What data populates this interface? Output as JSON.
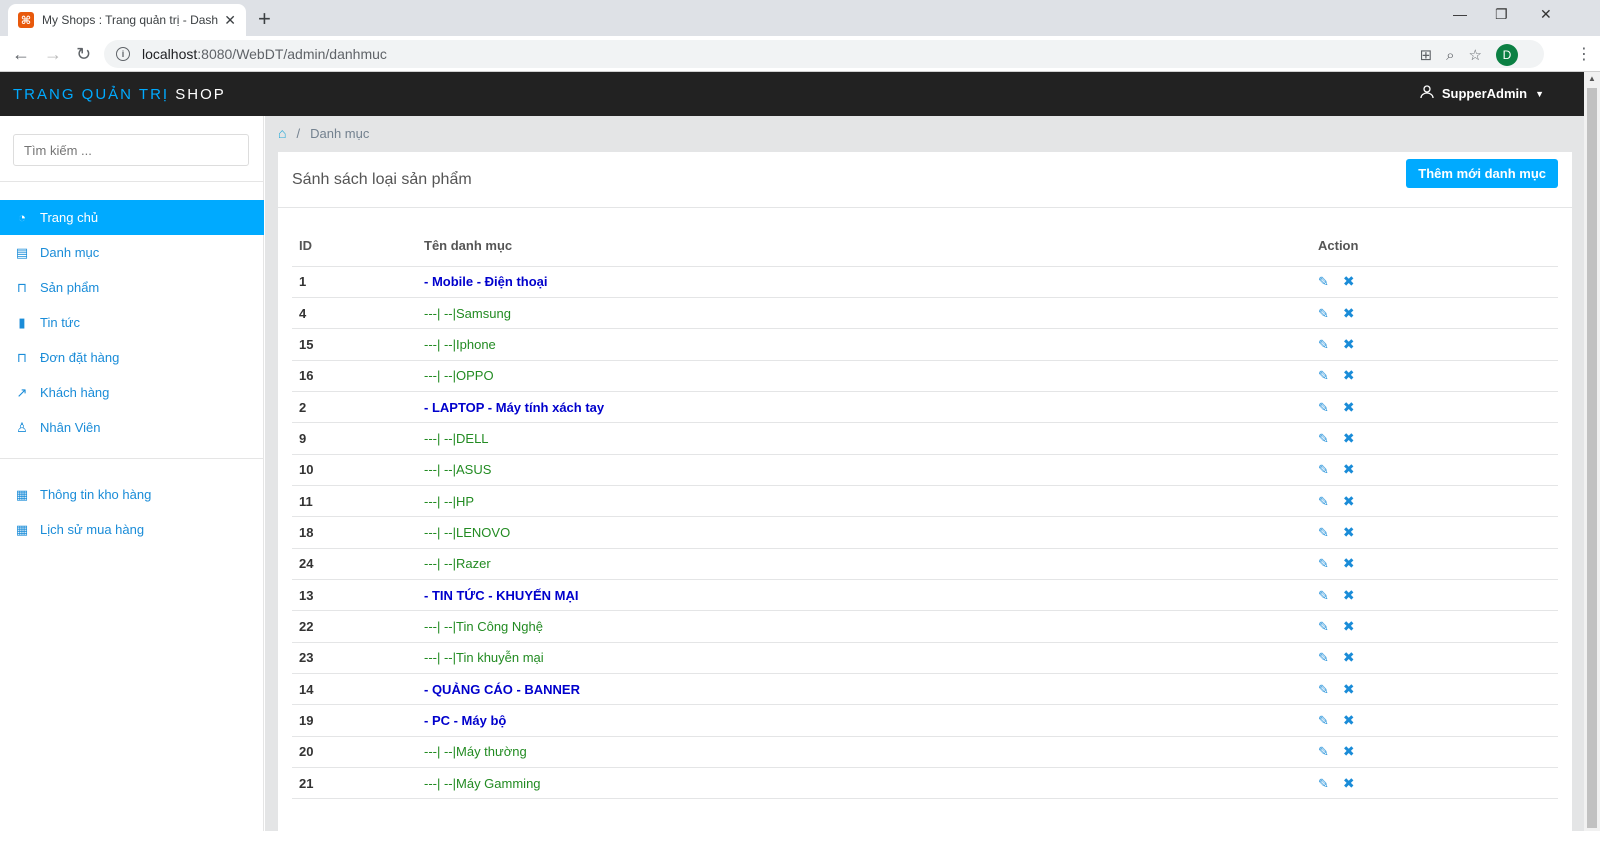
{
  "browser": {
    "tab_title": "My Shops : Trang quản trị - Dash",
    "url_host": "localhost",
    "url_rest": ":8080/WebDT/admin/danhmuc",
    "profile_initial": "D"
  },
  "header": {
    "brand_part1": "TRANG QUẢN TRỊ",
    "brand_part2": "SHOP",
    "user": "SupperAdmin"
  },
  "sidebar": {
    "search_placeholder": "Tìm kiếm ...",
    "items": [
      {
        "label": "Trang chủ",
        "icon": "dashboard-icon",
        "active": true
      },
      {
        "label": "Danh mục",
        "icon": "clipboard-icon"
      },
      {
        "label": "Sản phẩm",
        "icon": "bag-icon"
      },
      {
        "label": "Tin tức",
        "icon": "file-icon"
      },
      {
        "label": "Đơn đặt hàng",
        "icon": "bag-icon"
      },
      {
        "label": "Khách hàng",
        "icon": "chart-icon"
      },
      {
        "label": "Nhân Viên",
        "icon": "user-icon"
      }
    ],
    "items2": [
      {
        "label": "Thông tin kho hàng",
        "icon": "calendar-icon"
      },
      {
        "label": "Lịch sử mua hàng",
        "icon": "table-icon"
      }
    ]
  },
  "breadcrumb": {
    "current": "Danh mục"
  },
  "card": {
    "title": "Sánh sách loại sản phẩm",
    "add_button": "Thêm mới danh mục"
  },
  "table": {
    "headers": [
      "ID",
      "Tên danh mục",
      "Action"
    ],
    "rows": [
      {
        "id": "1",
        "name": "- Mobile - Điện thoại",
        "parent": true
      },
      {
        "id": "4",
        "name": "---| --|Samsung",
        "parent": false
      },
      {
        "id": "15",
        "name": "---| --|Iphone",
        "parent": false
      },
      {
        "id": "16",
        "name": "---| --|OPPO",
        "parent": false
      },
      {
        "id": "2",
        "name": "- LAPTOP - Máy tính xách tay",
        "parent": true
      },
      {
        "id": "9",
        "name": "---| --|DELL",
        "parent": false
      },
      {
        "id": "10",
        "name": "---| --|ASUS",
        "parent": false
      },
      {
        "id": "11",
        "name": "---| --|HP",
        "parent": false
      },
      {
        "id": "18",
        "name": "---| --|LENOVO",
        "parent": false
      },
      {
        "id": "24",
        "name": "---| --|Razer",
        "parent": false
      },
      {
        "id": "13",
        "name": "- TIN TỨC - KHUYẾN MẠI",
        "parent": true
      },
      {
        "id": "22",
        "name": "---| --|Tin Công Nghệ",
        "parent": false
      },
      {
        "id": "23",
        "name": "---| --|Tin khuyễn mại",
        "parent": false
      },
      {
        "id": "14",
        "name": "- QUẢNG CÁO - BANNER",
        "parent": true
      },
      {
        "id": "19",
        "name": "- PC - Máy bộ",
        "parent": true
      },
      {
        "id": "20",
        "name": "---| --|Máy thường",
        "parent": false
      },
      {
        "id": "21",
        "name": "---| --|Máy Gamming",
        "parent": false
      }
    ]
  },
  "colors": {
    "accent": "#00aaff",
    "navbar": "#222222",
    "parent_text": "#0000cc",
    "child_text": "#228b22"
  }
}
